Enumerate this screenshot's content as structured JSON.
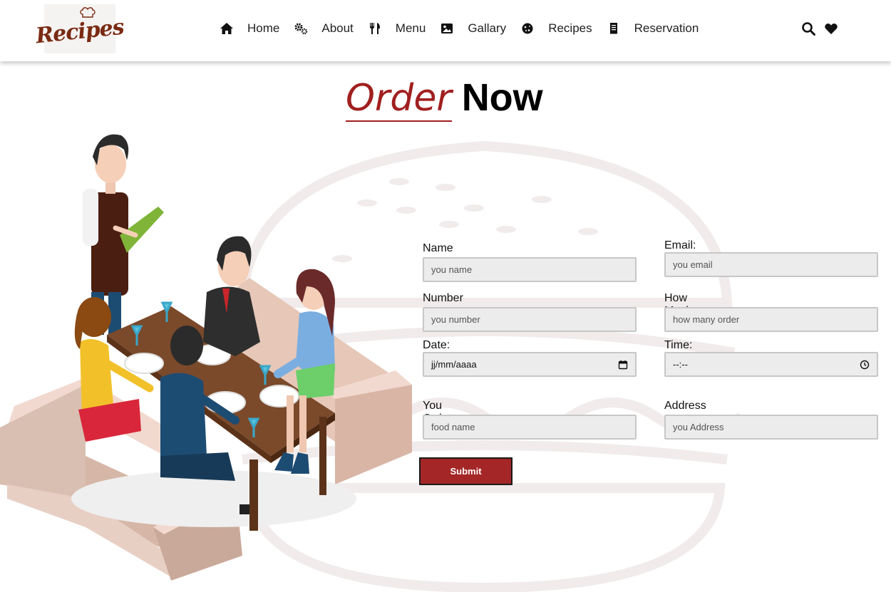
{
  "header": {
    "logo_text": "Recipes",
    "nav": [
      {
        "label": "Home",
        "icon": "home-icon"
      },
      {
        "label": "About",
        "icon": "gears-icon"
      },
      {
        "label": "Menu",
        "icon": "utensils-icon"
      },
      {
        "label": "Gallary",
        "icon": "image-icon"
      },
      {
        "label": "Recipes",
        "icon": "cookie-icon"
      },
      {
        "label": "Reservation",
        "icon": "receipt-icon"
      }
    ],
    "actions": [
      "search-icon",
      "heart-icon"
    ]
  },
  "title": {
    "accent": "Order",
    "main": "Now"
  },
  "form": {
    "name": {
      "label": "Name",
      "placeholder": "you name"
    },
    "email": {
      "label": "Email:",
      "placeholder": "you email"
    },
    "number": {
      "label": "Number",
      "placeholder": "you number"
    },
    "how_much": {
      "label": "How Much",
      "placeholder": "how many order"
    },
    "date": {
      "label": "Date:",
      "value": "jj/mm/aaaa",
      "icon": "calendar-icon"
    },
    "time": {
      "label": "Time:",
      "value": "--:--",
      "icon": "clock-icon"
    },
    "order": {
      "label": "You Order",
      "placeholder": "food name"
    },
    "address": {
      "label": "Address",
      "placeholder": "you Address"
    },
    "submit_label": "Submit"
  },
  "colors": {
    "accent": "#a52626",
    "input_bg": "#ececec",
    "input_border": "#c7c7c7"
  }
}
